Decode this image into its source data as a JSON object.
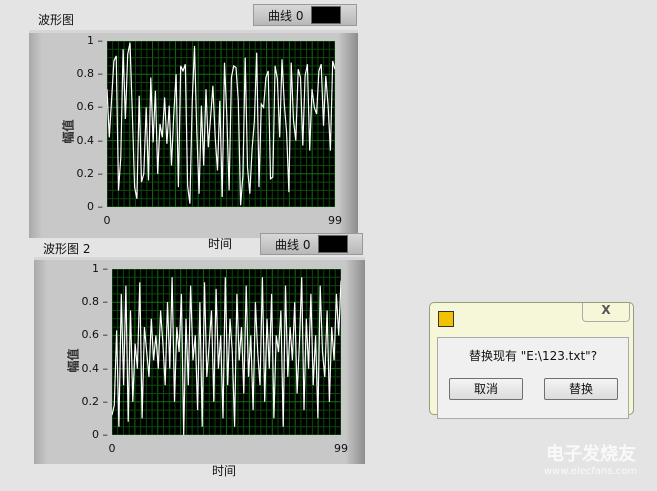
{
  "graphs": [
    {
      "title": "波形图",
      "legend": "曲线 0",
      "ylabel": "幅值",
      "xlabel": "时间"
    },
    {
      "title": "波形图 2",
      "legend": "曲线 0",
      "ylabel": "幅值",
      "xlabel": "时间"
    }
  ],
  "dialog": {
    "message": "替换现有 \"E:\\123.txt\"?",
    "cancel": "取消",
    "replace": "替换",
    "close": "X"
  },
  "watermark": {
    "brand": "电子发烧友",
    "url": "www.elecfans.com"
  },
  "chart_data": [
    {
      "type": "line",
      "title": "波形图",
      "xlabel": "时间",
      "ylabel": "幅值",
      "xlim": [
        0,
        99
      ],
      "ylim": [
        0,
        1
      ],
      "x_ticks": [
        "0",
        "99"
      ],
      "y_ticks": [
        "0",
        "0.2",
        "0.4",
        "0.6",
        "0.8",
        "1"
      ],
      "series": [
        {
          "name": "曲线 0",
          "values": [
            0.71,
            0.42,
            0.65,
            0.88,
            0.91,
            0.1,
            0.3,
            0.95,
            0.53,
            0.92,
            0.99,
            0.57,
            0.12,
            0.05,
            0.67,
            0.15,
            0.2,
            0.6,
            0.16,
            0.78,
            0.39,
            0.7,
            0.2,
            0.5,
            0.42,
            0.66,
            0.38,
            0.61,
            0.25,
            0.56,
            0.8,
            0.12,
            0.85,
            0.82,
            0.86,
            0.13,
            0.02,
            0.63,
            0.97,
            0.45,
            0.08,
            0.61,
            0.25,
            0.71,
            0.36,
            0.54,
            0.73,
            0.42,
            0.22,
            0.64,
            0.06,
            0.87,
            0.55,
            0.1,
            0.78,
            0.85,
            0.84,
            0.64,
            0.01,
            0.19,
            0.9,
            0.24,
            0.08,
            0.35,
            0.52,
            0.93,
            0.12,
            0.62,
            0.6,
            0.78,
            0.82,
            0.17,
            0.18,
            0.85,
            0.77,
            0.42,
            0.89,
            0.62,
            0.45,
            0.09,
            0.87,
            0.52,
            0.4,
            0.83,
            0.78,
            0.37,
            0.79,
            0.86,
            0.34,
            0.71,
            0.6,
            0.56,
            0.82,
            0.86,
            0.49,
            0.79,
            0.61,
            0.34,
            0.88,
            0.83
          ]
        }
      ]
    },
    {
      "type": "line",
      "title": "波形图 2",
      "xlabel": "时间",
      "ylabel": "幅值",
      "xlim": [
        0,
        99
      ],
      "ylim": [
        0,
        1
      ],
      "x_ticks": [
        "0",
        "99"
      ],
      "y_ticks": [
        "0",
        "0.2",
        "0.4",
        "0.6",
        "0.8",
        "1"
      ],
      "series": [
        {
          "name": "曲线 0",
          "values": [
            0.12,
            0.18,
            0.63,
            0.05,
            0.85,
            0.3,
            0.9,
            0.08,
            0.75,
            0.2,
            0.55,
            0.4,
            0.92,
            0.1,
            0.65,
            0.5,
            0.35,
            0.7,
            0.45,
            0.6,
            0.4,
            0.75,
            0.55,
            0.3,
            0.8,
            0.4,
            0.95,
            0.2,
            0.65,
            0.5,
            0.85,
            0.0,
            0.7,
            0.3,
            0.9,
            0.45,
            0.6,
            0.15,
            0.8,
            0.05,
            0.92,
            0.35,
            0.55,
            0.75,
            0.2,
            0.88,
            0.4,
            0.6,
            0.1,
            0.95,
            0.3,
            0.7,
            0.5,
            0.05,
            0.85,
            0.45,
            0.65,
            0.25,
            0.9,
            0.35,
            0.6,
            0.15,
            0.8,
            0.5,
            0.3,
            0.95,
            0.2,
            0.7,
            0.4,
            0.85,
            0.1,
            0.6,
            0.5,
            0.75,
            0.05,
            0.9,
            0.35,
            0.65,
            0.45,
            0.8,
            0.25,
            0.55,
            0.95,
            0.15,
            0.7,
            0.4,
            0.85,
            0.3,
            0.6,
            0.1,
            0.9,
            0.5,
            0.35,
            0.75,
            0.2,
            0.65,
            0.45,
            0.85,
            0.6,
            0.93
          ]
        }
      ]
    }
  ]
}
